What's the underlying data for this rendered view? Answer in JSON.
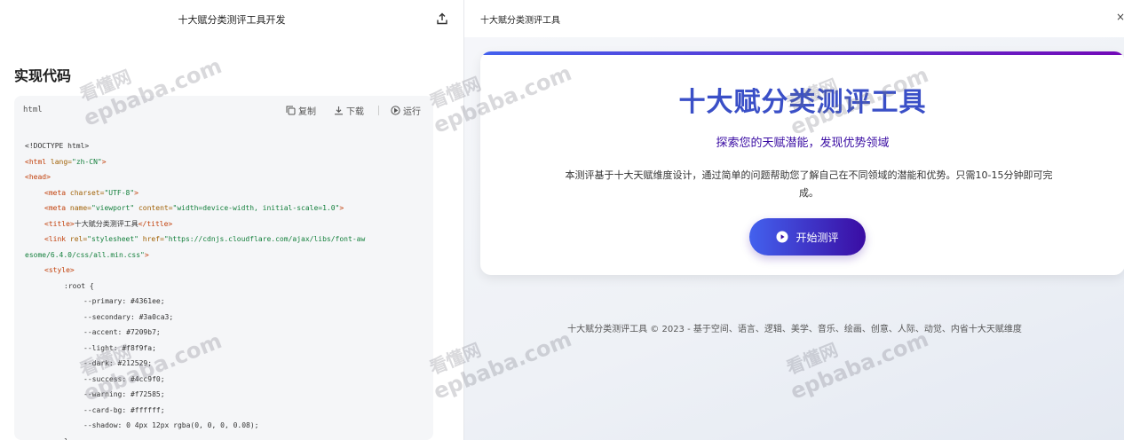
{
  "left_panel": {
    "title": "十大赋分类测评工具开发",
    "share_icon": "share-upload-icon",
    "section_heading": "实现代码",
    "code_card": {
      "language": "html",
      "copy_label": "复制",
      "download_label": "下载",
      "run_label": "运行",
      "lines": [
        {
          "indent": 0,
          "parts": [
            {
              "c": "t-txt",
              "t": "<!DOCTYPE html>"
            }
          ]
        },
        {
          "indent": 0,
          "parts": [
            {
              "c": "t-tag",
              "t": "<html "
            },
            {
              "c": "t-attr",
              "t": "lang="
            },
            {
              "c": "t-str",
              "t": "\"zh-CN\""
            },
            {
              "c": "t-tag",
              "t": ">"
            }
          ]
        },
        {
          "indent": 0,
          "parts": [
            {
              "c": "t-tag",
              "t": "<head>"
            }
          ]
        },
        {
          "indent": 1,
          "parts": [
            {
              "c": "t-tag",
              "t": "<meta "
            },
            {
              "c": "t-attr",
              "t": "charset="
            },
            {
              "c": "t-str",
              "t": "\"UTF-8\""
            },
            {
              "c": "t-tag",
              "t": ">"
            }
          ]
        },
        {
          "indent": 1,
          "parts": [
            {
              "c": "t-tag",
              "t": "<meta "
            },
            {
              "c": "t-attr",
              "t": "name="
            },
            {
              "c": "t-str",
              "t": "\"viewport\" "
            },
            {
              "c": "t-attr",
              "t": "content="
            },
            {
              "c": "t-str",
              "t": "\"width=device-width, initial-scale=1.0\""
            },
            {
              "c": "t-tag",
              "t": ">"
            }
          ]
        },
        {
          "indent": 1,
          "parts": [
            {
              "c": "t-tag",
              "t": "<title>"
            },
            {
              "c": "t-txt",
              "t": "十大赋分类测评工具"
            },
            {
              "c": "t-tag",
              "t": "</title>"
            }
          ]
        },
        {
          "indent": 1,
          "parts": [
            {
              "c": "t-tag",
              "t": "<link "
            },
            {
              "c": "t-attr",
              "t": "rel="
            },
            {
              "c": "t-str",
              "t": "\"stylesheet\" "
            },
            {
              "c": "t-attr",
              "t": "href="
            },
            {
              "c": "t-str",
              "t": "\"https://cdnjs.cloudflare.com/ajax/libs/font-aw"
            }
          ]
        },
        {
          "indent": 0,
          "parts": [
            {
              "c": "t-str",
              "t": "esome/6.4.0/css/all.min.css\""
            },
            {
              "c": "t-tag",
              "t": ">"
            }
          ]
        },
        {
          "indent": 1,
          "parts": [
            {
              "c": "t-tag",
              "t": "<style>"
            }
          ]
        },
        {
          "indent": 2,
          "parts": [
            {
              "c": "t-txt",
              "t": ":root {"
            }
          ]
        },
        {
          "indent": 3,
          "parts": [
            {
              "c": "t-txt",
              "t": "--primary: #4361ee;"
            }
          ]
        },
        {
          "indent": 3,
          "parts": [
            {
              "c": "t-txt",
              "t": "--secondary: #3a0ca3;"
            }
          ]
        },
        {
          "indent": 3,
          "parts": [
            {
              "c": "t-txt",
              "t": "--accent: #7209b7;"
            }
          ]
        },
        {
          "indent": 3,
          "parts": [
            {
              "c": "t-txt",
              "t": "--light: #f8f9fa;"
            }
          ]
        },
        {
          "indent": 3,
          "parts": [
            {
              "c": "t-txt",
              "t": "--dark: #212529;"
            }
          ]
        },
        {
          "indent": 3,
          "parts": [
            {
              "c": "t-txt",
              "t": "--success: #4cc9f0;"
            }
          ]
        },
        {
          "indent": 3,
          "parts": [
            {
              "c": "t-txt",
              "t": "--warning: #f72585;"
            }
          ]
        },
        {
          "indent": 3,
          "parts": [
            {
              "c": "t-txt",
              "t": "--card-bg: #ffffff;"
            }
          ]
        },
        {
          "indent": 3,
          "parts": [
            {
              "c": "t-txt",
              "t": "--shadow: 0 4px 12px rgba(0, 0, 0, 0.08);"
            }
          ]
        },
        {
          "indent": 2,
          "parts": [
            {
              "c": "t-txt",
              "t": "}"
            }
          ]
        }
      ]
    }
  },
  "right_panel": {
    "title": "十大赋分类测评工具",
    "close_label": "×",
    "card": {
      "title": "十大赋分类测评工具",
      "subtitle": "探索您的天赋潜能，发现优势领域",
      "description": "本测评基于十大天赋维度设计，通过简单的问题帮助您了解自己在不同领域的潜能和优势。只需10-15分钟即可完成。",
      "start_button": "开始测评",
      "start_icon": "play-circle-icon"
    },
    "footer": "十大赋分类测评工具 © 2023 - 基于空间、语言、逻辑、美学、音乐、绘画、创意、人际、动觉、内省十大天赋维度"
  },
  "watermark": {
    "cn": "看懂网",
    "en": "epbaba.com"
  },
  "colors": {
    "primary": "#4361ee",
    "secondary": "#3a0ca3",
    "accent": "#7209b7"
  }
}
